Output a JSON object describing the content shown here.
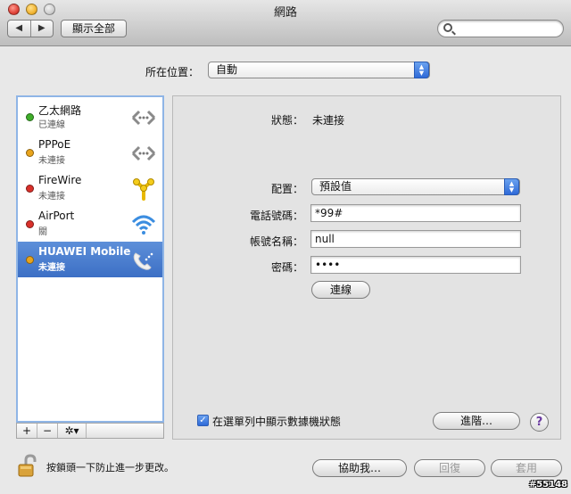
{
  "window": {
    "title": "網路"
  },
  "toolbar": {
    "back": "◀",
    "forward": "▶",
    "show_all": "顯示全部",
    "search_placeholder": ""
  },
  "location": {
    "label": "所在位置：",
    "value": "自動"
  },
  "services": [
    {
      "name": "乙太網路",
      "status": "已連線",
      "dot_color": "#3fae2a",
      "icon": "ethernet-icon"
    },
    {
      "name": "PPPoE",
      "status": "未連接",
      "dot_color": "#e9a41c",
      "icon": "ethernet-icon"
    },
    {
      "name": "FireWire",
      "status": "未連接",
      "dot_color": "#d9302a",
      "icon": "firewire-icon"
    },
    {
      "name": "AirPort",
      "status": "關",
      "dot_color": "#d9302a",
      "icon": "wifi-icon"
    },
    {
      "name": "HUAWEI Mobile",
      "status": "未連接",
      "dot_color": "#e9a41c",
      "icon": "phone-modem-icon",
      "selected": true
    }
  ],
  "sidebar_buttons": {
    "add": "+",
    "remove": "−",
    "action": "✲▾"
  },
  "detail": {
    "status_label": "狀態：",
    "status_value": "未連接",
    "config_label": "配置：",
    "config_value": "預設值",
    "phone_label": "電話號碼：",
    "phone_value": "*99#",
    "account_label": "帳號名稱：",
    "account_value": "null",
    "password_label": "密碼：",
    "password_value": "••••",
    "connect_button": "連線",
    "show_modem_status": "在選單列中顯示數據機狀態",
    "advanced_button": "進階…",
    "help_button": "?"
  },
  "footer": {
    "lock_text": "按鎖頭一下防止進一步更改。",
    "assist_button": "協助我…",
    "revert_button": "回復",
    "apply_button": "套用"
  },
  "watermark": "#55148",
  "colors": {
    "selection": "#3c6fc5",
    "accent": "#2f6ad8",
    "focus_ring": "#8fb5e6"
  }
}
